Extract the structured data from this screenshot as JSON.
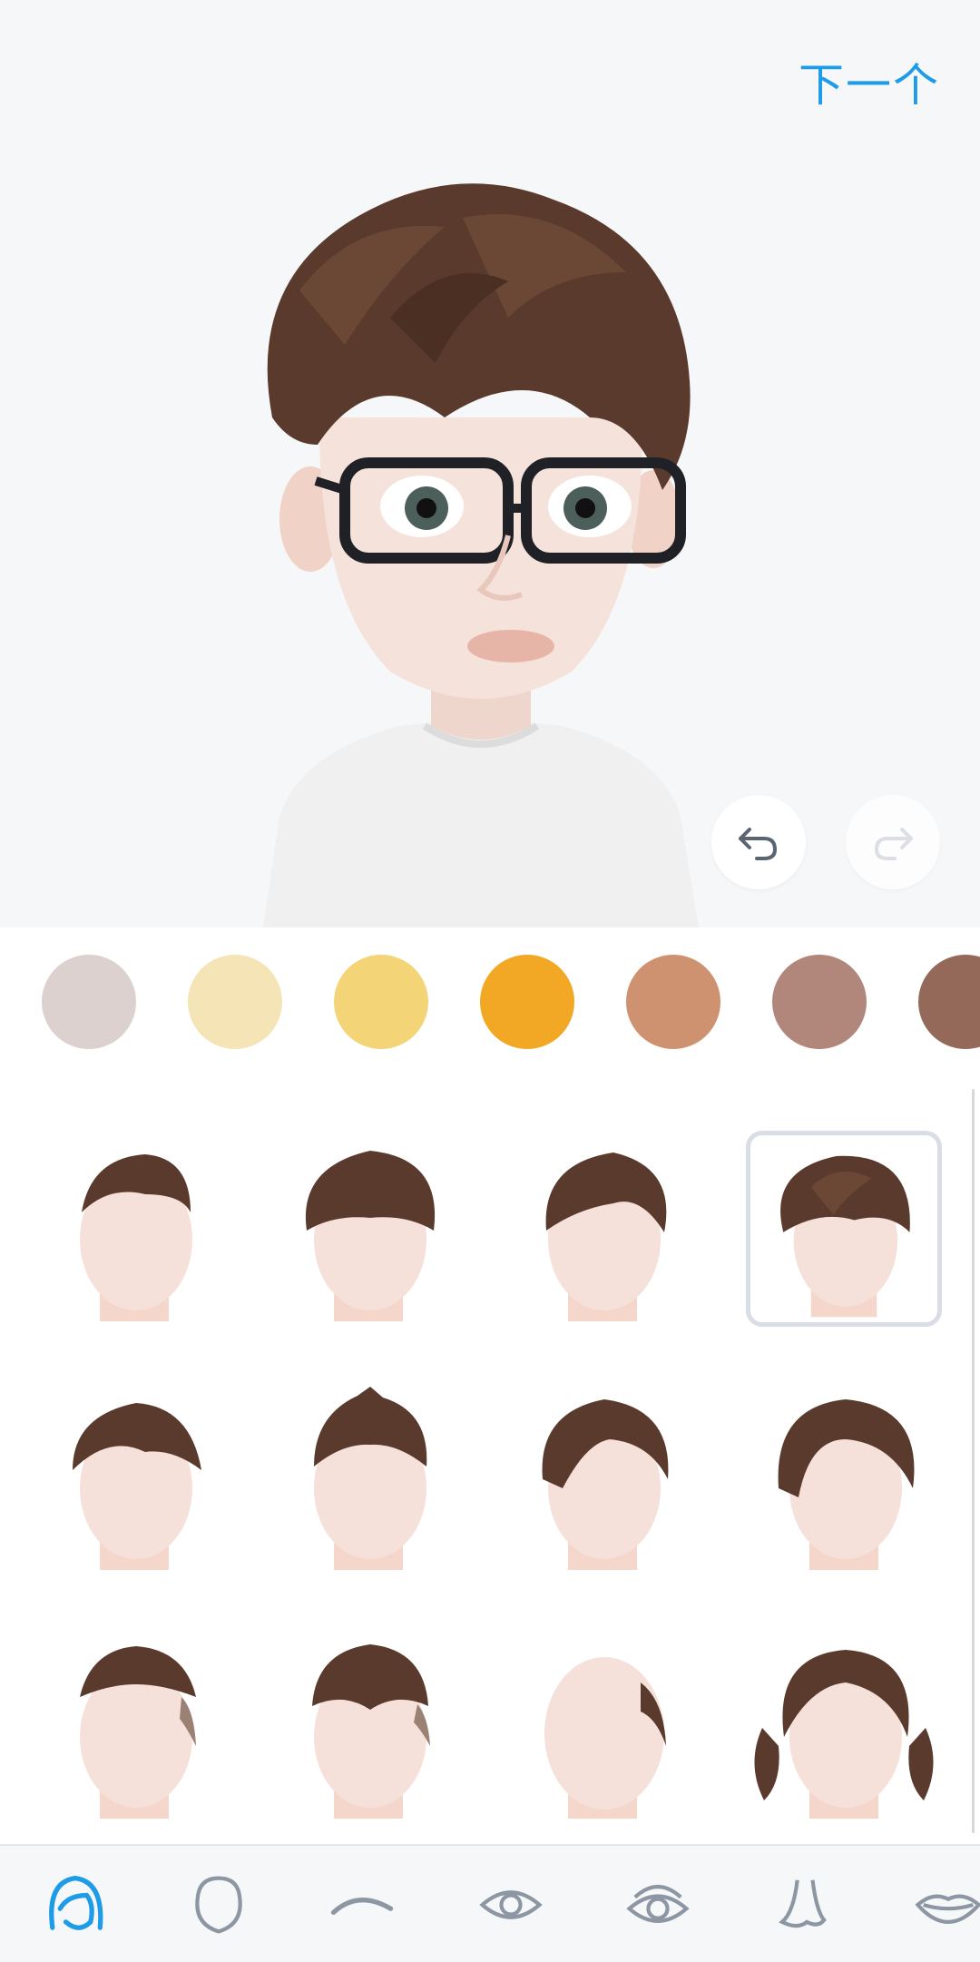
{
  "header": {
    "next_label": "下一个"
  },
  "colors": {
    "accent": "#1e9ce8",
    "hair_palette": [
      "#dcd1ce",
      "#f5e4b6",
      "#f3d476",
      "#f2a725",
      "#cf9270",
      "#b0877a",
      "#94695a"
    ]
  },
  "history": {
    "undo_icon": "undo-icon",
    "redo_icon": "redo-icon"
  },
  "hairstyles": {
    "selected_index": 3,
    "items": [
      "hair-1",
      "hair-2",
      "hair-3",
      "hair-4",
      "hair-5",
      "hair-6",
      "hair-7",
      "hair-8",
      "hair-9",
      "hair-10",
      "hair-11",
      "hair-12"
    ]
  },
  "bottom_nav": {
    "items": [
      "hair-icon",
      "face-shape-icon",
      "eyebrow-icon",
      "eye-icon",
      "eye-detail-icon",
      "nose-icon",
      "lips-icon"
    ],
    "active_index": 0
  }
}
